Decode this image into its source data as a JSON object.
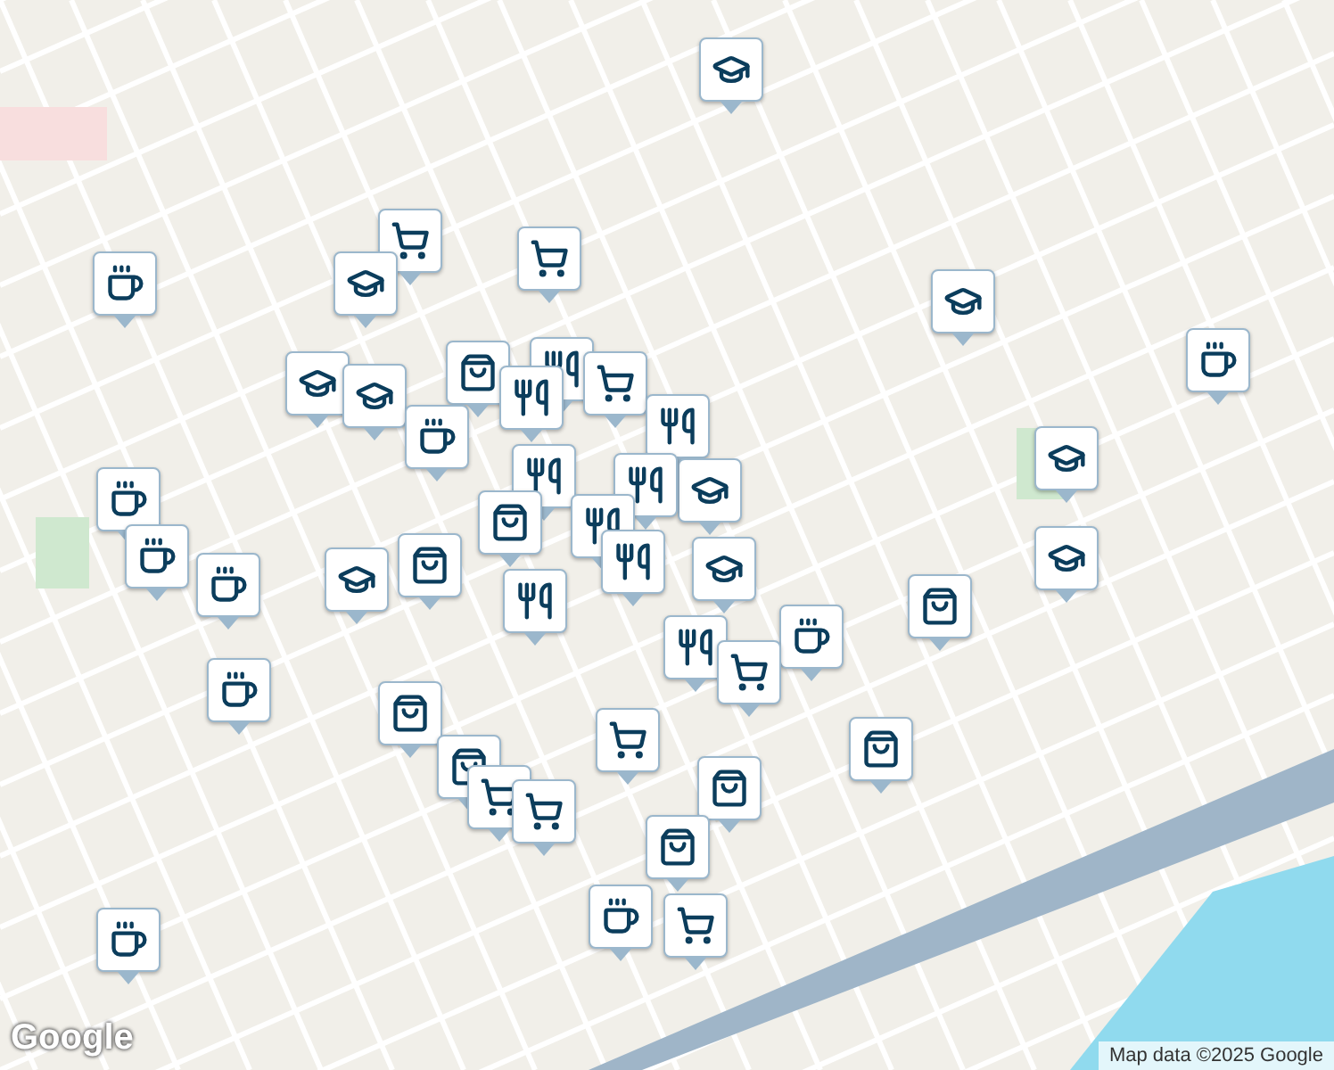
{
  "map": {
    "pins": [
      {
        "kind": "school"
      },
      {
        "kind": "cart"
      },
      {
        "kind": "school"
      },
      {
        "kind": "cart"
      },
      {
        "kind": "cafe"
      },
      {
        "kind": "school"
      },
      {
        "kind": "cafe"
      },
      {
        "kind": "school"
      },
      {
        "kind": "school"
      },
      {
        "kind": "bag"
      },
      {
        "kind": "restaurant"
      },
      {
        "kind": "cart"
      },
      {
        "kind": "restaurant"
      },
      {
        "kind": "cafe"
      },
      {
        "kind": "restaurant"
      },
      {
        "kind": "cafe"
      },
      {
        "kind": "restaurant"
      },
      {
        "kind": "school"
      },
      {
        "kind": "restaurant"
      },
      {
        "kind": "bag"
      },
      {
        "kind": "bag"
      },
      {
        "kind": "restaurant"
      },
      {
        "kind": "restaurant"
      },
      {
        "kind": "school"
      },
      {
        "kind": "school"
      },
      {
        "kind": "school"
      },
      {
        "kind": "cafe"
      },
      {
        "kind": "cafe"
      },
      {
        "kind": "school"
      },
      {
        "kind": "restaurant"
      },
      {
        "kind": "restaurant"
      },
      {
        "kind": "bag"
      },
      {
        "kind": "cafe"
      },
      {
        "kind": "cart"
      },
      {
        "kind": "cafe"
      },
      {
        "kind": "bag"
      },
      {
        "kind": "cart"
      },
      {
        "kind": "bag"
      },
      {
        "kind": "bag"
      },
      {
        "kind": "cart"
      },
      {
        "kind": "cart"
      },
      {
        "kind": "bag"
      },
      {
        "kind": "bag"
      },
      {
        "kind": "cart"
      },
      {
        "kind": "cafe"
      },
      {
        "kind": "cafe"
      }
    ]
  },
  "logo": "Google",
  "attribution": "Map data ©2025 Google"
}
